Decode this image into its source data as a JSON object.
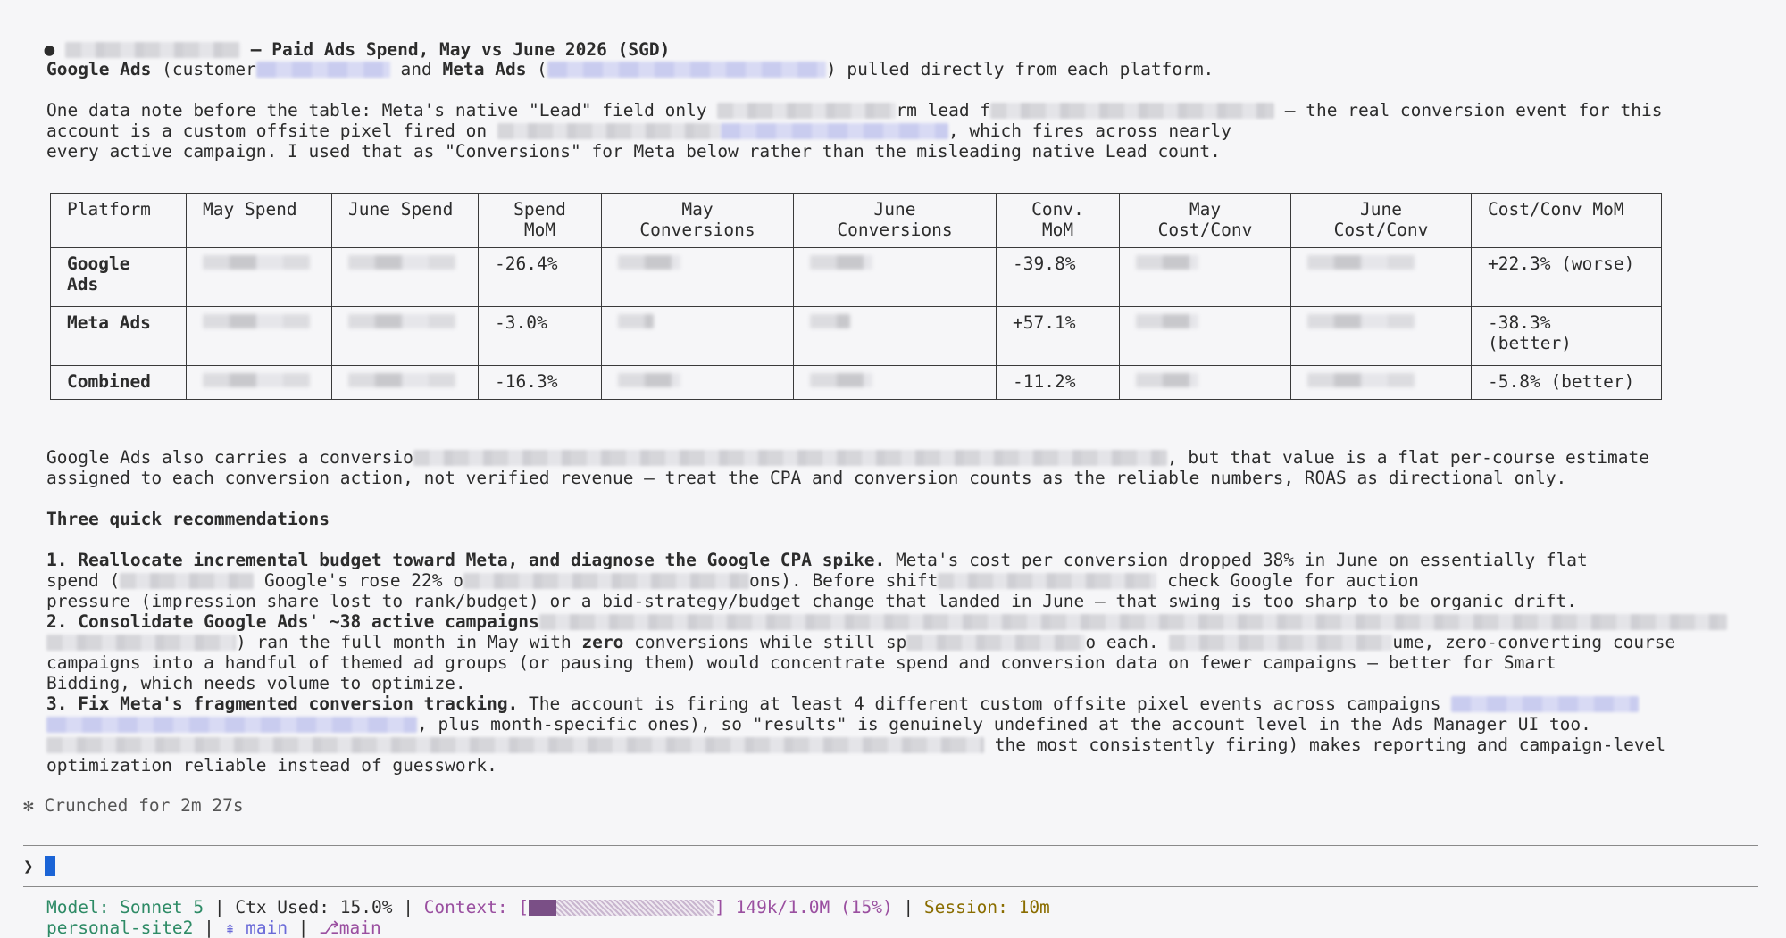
{
  "header": {
    "bullet": "●",
    "title": "— Paid Ads Spend, May vs June 2026 (SGD)"
  },
  "intro": {
    "google_label": "Google Ads",
    "customer_prefix": " (customer",
    "and_text": " and ",
    "meta_label": "Meta Ads",
    "paren_open": " (",
    "pulled_text": ") pulled directly from each platform."
  },
  "note": {
    "line1_a": "One data note before the table: Meta's native \"Lead\" field only",
    "line1_b": "rm lead f",
    "line1_c": "— the real conversion event for this",
    "line2_a": "account is a custom offsite pixel fired on",
    "line2_b": ", which fires across nearly",
    "line3": "every active campaign. I used that as \"Conversions\" for Meta below rather than the misleading native Lead count."
  },
  "table": {
    "headers": [
      "Platform",
      "May Spend",
      "June Spend",
      "Spend\nMoM",
      "May\nConversions",
      "June\nConversions",
      "Conv.\nMoM",
      "May\nCost/Conv",
      "June\nCost/Conv",
      "Cost/Conv MoM"
    ],
    "rows": [
      {
        "platform": "Google\nAds",
        "spend_mom": "-26.4%",
        "conv_mom": "-39.8%",
        "cost_conv_mom": "+22.3% (worse)"
      },
      {
        "platform": "Meta Ads",
        "spend_mom": "-3.0%",
        "conv_mom": "+57.1%",
        "cost_conv_mom": "-38.3%\n(better)"
      },
      {
        "platform": "Combined",
        "spend_mom": "-16.3%",
        "conv_mom": "-11.2%",
        "cost_conv_mom": "-5.8% (better)"
      }
    ]
  },
  "roas_note": {
    "line1_a": "Google Ads also carries a conversio",
    "line1_b": ", but that value is a flat per-course estimate",
    "line2": "assigned to each conversion action, not verified revenue — treat the CPA and conversion counts as the reliable numbers, ROAS as directional only."
  },
  "recs": {
    "heading": "Three quick recommendations",
    "r1_bold": "1. Reallocate incremental budget toward Meta, and diagnose the Google CPA spike.",
    "r1_a": " Meta's cost per conversion dropped 38% in June on essentially flat",
    "r1_b": "spend (",
    "r1_c": "Google's rose 22% o",
    "r1_d": "ons). Before shift",
    "r1_e": "check Google for auction",
    "r1_f": "pressure (impression share lost to rank/budget) or a bid-strategy/budget change that landed in June — that swing is too sharp to be organic drift.",
    "r2_bold": "2. Consolidate Google Ads' ~38 active campaigns",
    "r2_a": ") ran the full month in May with ",
    "r2_zero": "zero",
    "r2_b": " conversions while still sp",
    "r2_c": "o each.",
    "r2_d": "ume, zero-converting course",
    "r2_e": "campaigns into a handful of themed ad groups (or pausing them) would concentrate spend and conversion data on fewer campaigns — better for Smart",
    "r2_f": "Bidding, which needs volume to optimize.",
    "r3_bold": "3. Fix Meta's fragmented conversion tracking.",
    "r3_a": " The account is firing at least 4 different custom offsite pixel events across campaigns",
    "r3_b": ", plus month-specific ones), so \"results\" is genuinely undefined at the account level in the Ads Manager UI too.",
    "r3_c": "the most consistently firing) makes reporting and campaign-level",
    "r3_d": "optimization reliable instead of guesswork."
  },
  "status": {
    "icon": "✻",
    "text": "Crunched for 2m 27s"
  },
  "prompt": {
    "symbol": "❯"
  },
  "footer": {
    "model": "Model: Sonnet 5",
    "sep1": " | ",
    "ctx": "Ctx Used: 15.0%",
    "sep2": " | ",
    "context_label": "Context: [",
    "context_close": "]",
    "context_value": " 149k/1.0M (15%)",
    "context_fill": 0.15,
    "sep3": " | ",
    "session": "Session: 10m",
    "project": "personal-site2",
    "sep4": " | ",
    "branch_icon": "⇞",
    "branch": " main",
    "sep5": " | ",
    "worktree_icon": "⎇",
    "worktree": "main"
  },
  "colors": {
    "accent_green": "#2e8b66",
    "context_purple": "#9a4fa0",
    "session_olive": "#8a6d00",
    "cursor_blue": "#1b64d6"
  }
}
